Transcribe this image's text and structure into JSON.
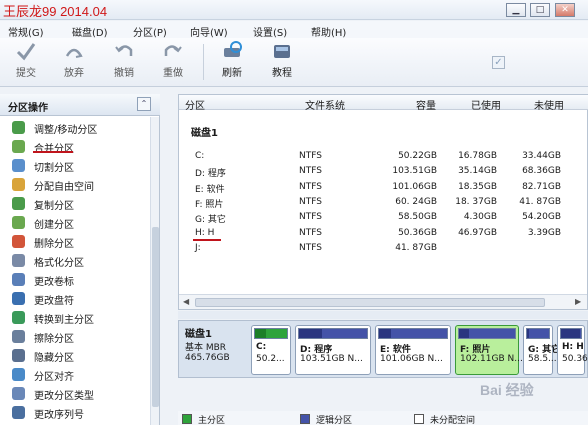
{
  "window": {
    "title": "王辰龙99 2014.04"
  },
  "menu": [
    "常规(G)",
    "磁盘(D)",
    "分区(P)",
    "向导(W)",
    "设置(S)",
    "帮助(H)"
  ],
  "toolbar": {
    "items": [
      {
        "label": "提交",
        "icon": "check-icon"
      },
      {
        "label": "放弃",
        "icon": "discard-icon"
      },
      {
        "label": "撤销",
        "icon": "undo-icon"
      },
      {
        "label": "重做",
        "icon": "redo-icon"
      },
      {
        "label": "刷新",
        "icon": "refresh-icon"
      },
      {
        "label": "教程",
        "icon": "tutorial-icon"
      }
    ]
  },
  "sidebar": {
    "title": "分区操作",
    "items": [
      "调整/移动分区",
      "合并分区",
      "切割分区",
      "分配自由空间",
      "复制分区",
      "创建分区",
      "删除分区",
      "格式化分区",
      "更改卷标",
      "更改盘符",
      "转换到主分区",
      "擦除分区",
      "隐藏分区",
      "分区对齐",
      "更改分区类型",
      "更改序列号"
    ]
  },
  "table": {
    "headers": [
      "分区",
      "文件系统",
      "容量",
      "已使用",
      "未使用"
    ],
    "disk_label": "磁盘1",
    "rows": [
      {
        "name": "C:",
        "fs": "NTFS",
        "cap": "50.22GB",
        "used": "16.78GB",
        "free": "33.44GB"
      },
      {
        "name": "D: 程序",
        "fs": "NTFS",
        "cap": "103.51GB",
        "used": "35.14GB",
        "free": "68.36GB"
      },
      {
        "name": "E: 软件",
        "fs": "NTFS",
        "cap": "101.06GB",
        "used": "18.35GB",
        "free": "82.71GB"
      },
      {
        "name": "F: 照片",
        "fs": "NTFS",
        "cap": "60. 24GB",
        "used": "18. 37GB",
        "free": "41. 87GB"
      },
      {
        "name": "G: 其它",
        "fs": "NTFS",
        "cap": "58.50GB",
        "used": "4.30GB",
        "free": "54.20GB"
      },
      {
        "name": "H: H",
        "fs": "NTFS",
        "cap": "50.36GB",
        "used": "46.97GB",
        "free": "3.39GB"
      },
      {
        "name": "J:",
        "fs": "NTFS",
        "cap": "41. 87GB",
        "used": "",
        "free": ""
      }
    ]
  },
  "diskmap": {
    "disk_name": "磁盘1",
    "disk_type": "基本 MBR",
    "disk_size": "465.76GB",
    "parts": [
      {
        "name": "C:",
        "size": "50.2...",
        "type": "primary",
        "used_fraction": 0.33
      },
      {
        "name": "D: 程序",
        "size": "103.51GB N...",
        "type": "logical",
        "used_fraction": 0.34
      },
      {
        "name": "E: 软件",
        "size": "101.06GB N...",
        "type": "logical",
        "used_fraction": 0.18
      },
      {
        "name": "F: 照片",
        "size": "102.11GB N...",
        "type": "logical",
        "used_fraction": 0.18
      },
      {
        "name": "G: 其它",
        "size": "58.5...",
        "type": "logical",
        "used_fraction": 0.07
      },
      {
        "name": "H: H",
        "size": "50.36...",
        "type": "logical",
        "used_fraction": 0.93
      }
    ]
  },
  "legend": [
    "主分区",
    "逻辑分区",
    "未分配空间"
  ],
  "watermark": "Bai 经验"
}
